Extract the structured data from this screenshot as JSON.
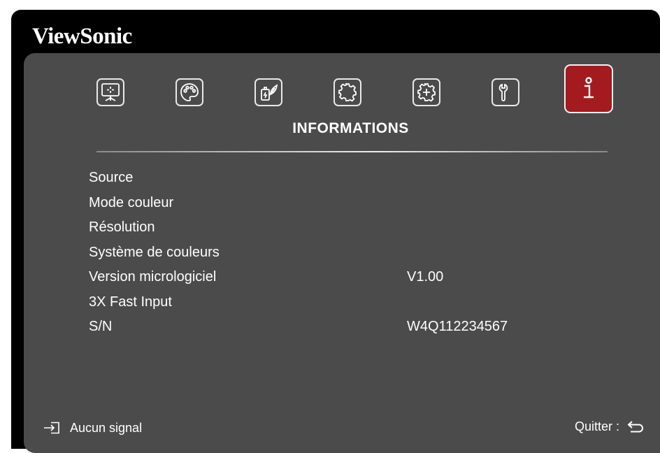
{
  "brand": "ViewSonic",
  "tabs": [
    {
      "name": "display",
      "icon": "display-icon",
      "active": false
    },
    {
      "name": "picture",
      "icon": "palette-icon",
      "active": false
    },
    {
      "name": "power",
      "icon": "power-management-icon",
      "active": false
    },
    {
      "name": "basic",
      "icon": "gear-icon",
      "active": false
    },
    {
      "name": "advanced",
      "icon": "advanced-gear-icon",
      "active": false
    },
    {
      "name": "system",
      "icon": "wrench-icon",
      "active": false
    },
    {
      "name": "information",
      "icon": "info-icon",
      "active": true
    }
  ],
  "menu_title": "INFORMATIONS",
  "rows": [
    {
      "label": "Source",
      "value": ""
    },
    {
      "label": "Mode couleur",
      "value": ""
    },
    {
      "label": "Résolution",
      "value": ""
    },
    {
      "label": "Système de couleurs",
      "value": ""
    },
    {
      "label": "Version micrologiciel",
      "value": "V1.00"
    },
    {
      "label": "3X Fast Input",
      "value": ""
    },
    {
      "label": "S/N",
      "value": "W4Q112234567"
    }
  ],
  "footer": {
    "input_icon": "input-source-icon",
    "status_label": "Aucun signal",
    "exit_label": "Quitter :",
    "exit_icon": "return-icon"
  },
  "colors": {
    "panel": "#4b4b4b",
    "frame": "#000000",
    "active_tab": "#a31b1e",
    "text": "#ffffff"
  }
}
